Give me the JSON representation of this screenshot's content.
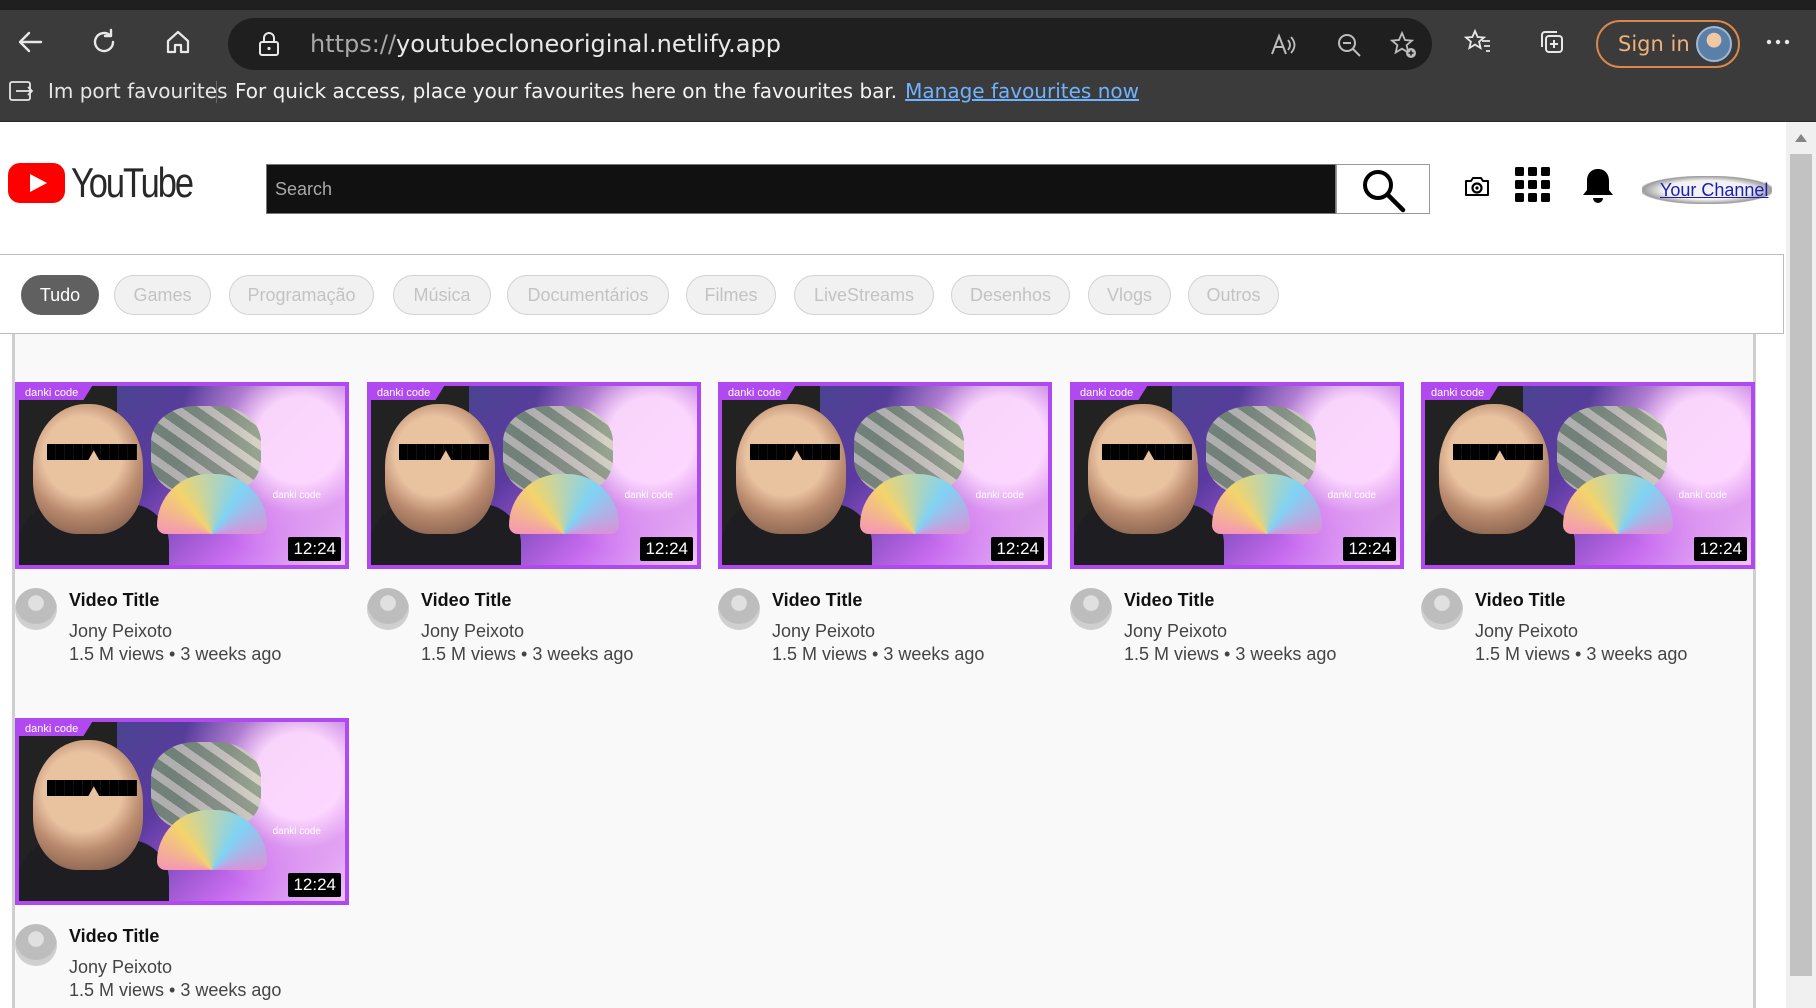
{
  "browser": {
    "url_scheme": "https://",
    "url_host": "youtubecloneoriginal.netlify.app",
    "signin_label": "Sign in",
    "fav_import_label": "Im port favourites",
    "fav_message": "For quick access, place your favourites here on the favourites bar.",
    "fav_link": "Manage favourites now",
    "accent_color": "#d9874a",
    "link_color": "#6fb3ff"
  },
  "header": {
    "logo_text": "YouTube",
    "search_placeholder": "Search",
    "your_channel": "Your Channel",
    "icons": [
      "camera-icon",
      "apps-grid-icon",
      "bell-icon",
      "search-icon"
    ]
  },
  "chips": [
    "Tudo",
    "Games",
    "Programação",
    "Música",
    "Documentários",
    "Filmes",
    "LiveStreams",
    "Desenhos",
    "Vlogs",
    "Outros"
  ],
  "videos": [
    {
      "title": "Video Title",
      "channel": "Jony Peixoto",
      "meta": "1.5 M views • 3 weeks ago",
      "duration": "12:24",
      "brand": "danki code",
      "brand_small": "danki code"
    },
    {
      "title": "Video Title",
      "channel": "Jony Peixoto",
      "meta": "1.5 M views • 3 weeks ago",
      "duration": "12:24",
      "brand": "danki code",
      "brand_small": "danki code"
    },
    {
      "title": "Video Title",
      "channel": "Jony Peixoto",
      "meta": "1.5 M views • 3 weeks ago",
      "duration": "12:24",
      "brand": "danki code",
      "brand_small": "danki code"
    },
    {
      "title": "Video Title",
      "channel": "Jony Peixoto",
      "meta": "1.5 M views • 3 weeks ago",
      "duration": "12:24",
      "brand": "danki code",
      "brand_small": "danki code"
    },
    {
      "title": "Video Title",
      "channel": "Jony Peixoto",
      "meta": "1.5 M views • 3 weeks ago",
      "duration": "12:24",
      "brand": "danki code",
      "brand_small": "danki code"
    },
    {
      "title": "Video Title",
      "channel": "Jony Peixoto",
      "meta": "1.5 M views • 3 weeks ago",
      "duration": "12:24",
      "brand": "danki code",
      "brand_small": "danki code"
    }
  ]
}
